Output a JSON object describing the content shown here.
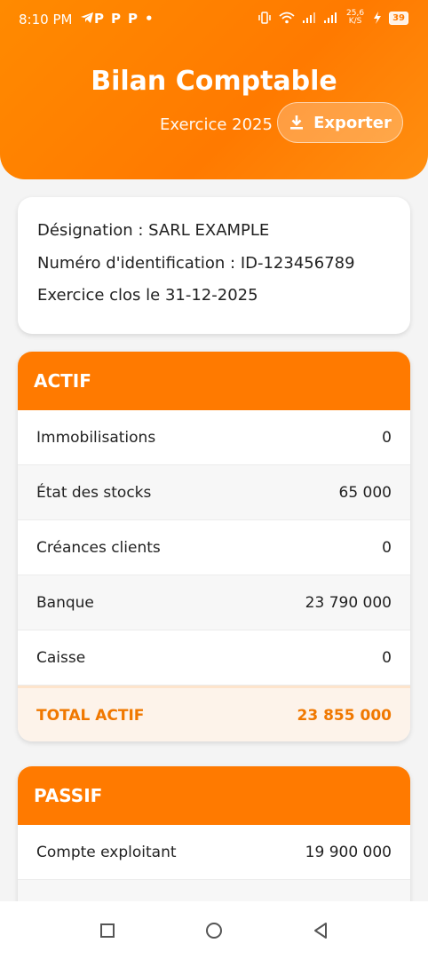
{
  "status_bar": {
    "time": "8:10 PM",
    "left_icons": [
      "telegram-icon",
      "p-icon",
      "p-icon",
      "p-icon",
      "dot-icon"
    ],
    "net_speed": "25,6 K/S",
    "battery": "39"
  },
  "header": {
    "title": "Bilan Comptable",
    "exercice": "Exercice 2025",
    "export_label": "Exporter"
  },
  "info": {
    "designation": "Désignation : SARL EXAMPLE",
    "identification": "Numéro d'identification : ID-123456789",
    "clos": "Exercice clos le 31-12-2025"
  },
  "actif": {
    "title": "ACTIF",
    "rows": [
      {
        "label": "Immobilisations",
        "value": "0"
      },
      {
        "label": "État des stocks",
        "value": "65 000"
      },
      {
        "label": "Créances clients",
        "value": "0"
      },
      {
        "label": "Banque",
        "value": "23 790 000"
      },
      {
        "label": "Caisse",
        "value": "0"
      }
    ],
    "total_label": "TOTAL ACTIF",
    "total_value": "23 855 000"
  },
  "passif": {
    "title": "PASSIF",
    "rows": [
      {
        "label": "Compte exploitant",
        "value": "19 900 000"
      }
    ]
  },
  "colors": {
    "accent": "#ff7a00",
    "total_text": "#f07800"
  }
}
